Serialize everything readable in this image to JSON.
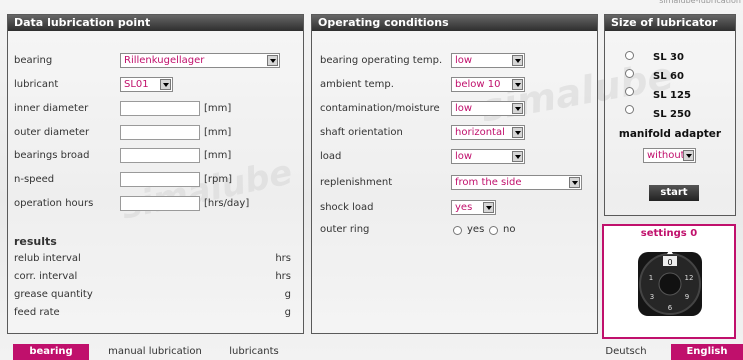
{
  "top_right_text": "simalube-lubrication",
  "watermark": {
    "text": "simalube"
  },
  "panel_data": {
    "title": "Data lubrication point",
    "bearing": {
      "label": "bearing",
      "value": "Rillenkugellager",
      "icon": "chevron-down-icon"
    },
    "lubricant": {
      "label": "lubricant",
      "value": "SL01",
      "icon": "chevron-down-icon"
    },
    "inner_diameter": {
      "label": "inner diameter",
      "unit": "[mm]",
      "value": ""
    },
    "outer_diameter": {
      "label": "outer diameter",
      "unit": "[mm]",
      "value": ""
    },
    "bearings_broad": {
      "label": "bearings broad",
      "unit": "[mm]",
      "value": ""
    },
    "n_speed": {
      "label": "n-speed",
      "unit": "[rpm]",
      "value": ""
    },
    "operation_hours": {
      "label": "operation hours",
      "unit": "[hrs/day]",
      "value": ""
    },
    "results": {
      "title": "results",
      "rows": [
        {
          "label": "relub interval",
          "unit": "hrs"
        },
        {
          "label": "corr. interval",
          "unit": "hrs"
        },
        {
          "label": "grease quantity",
          "unit": "g"
        },
        {
          "label": "feed rate",
          "unit": "g"
        }
      ]
    }
  },
  "panel_conditions": {
    "title": "Operating conditions",
    "rows": [
      {
        "label": "bearing operating temp.",
        "value": "low"
      },
      {
        "label": "ambient temp.",
        "value": "below 10"
      },
      {
        "label": "contamination/moisture",
        "value": "low"
      },
      {
        "label": "shaft orientation",
        "value": "horizontal"
      },
      {
        "label": "load",
        "value": "low"
      },
      {
        "label": "replenishment",
        "value": "from the side"
      },
      {
        "label": "shock load",
        "value": "yes"
      }
    ],
    "outer_ring": {
      "label": "outer ring",
      "options": [
        "yes",
        "no"
      ]
    }
  },
  "panel_size": {
    "title": "Size of lubricator",
    "options": [
      "SL 30",
      "SL 60",
      "SL 125",
      "SL 250"
    ],
    "manifold_label": "manifold adapter",
    "manifold_value": "without",
    "start_label": "start"
  },
  "settings": {
    "title": "settings 0",
    "dial_numbers": [
      "0",
      "12",
      "9",
      "6",
      "3",
      "1"
    ]
  },
  "tabs_left": [
    "bearing",
    "manual lubrication",
    "lubricants"
  ],
  "tabs_right": [
    "Deutsch",
    "English"
  ],
  "colors": {
    "accent": "#c0106c",
    "header_dark": "#2e2e2e"
  }
}
